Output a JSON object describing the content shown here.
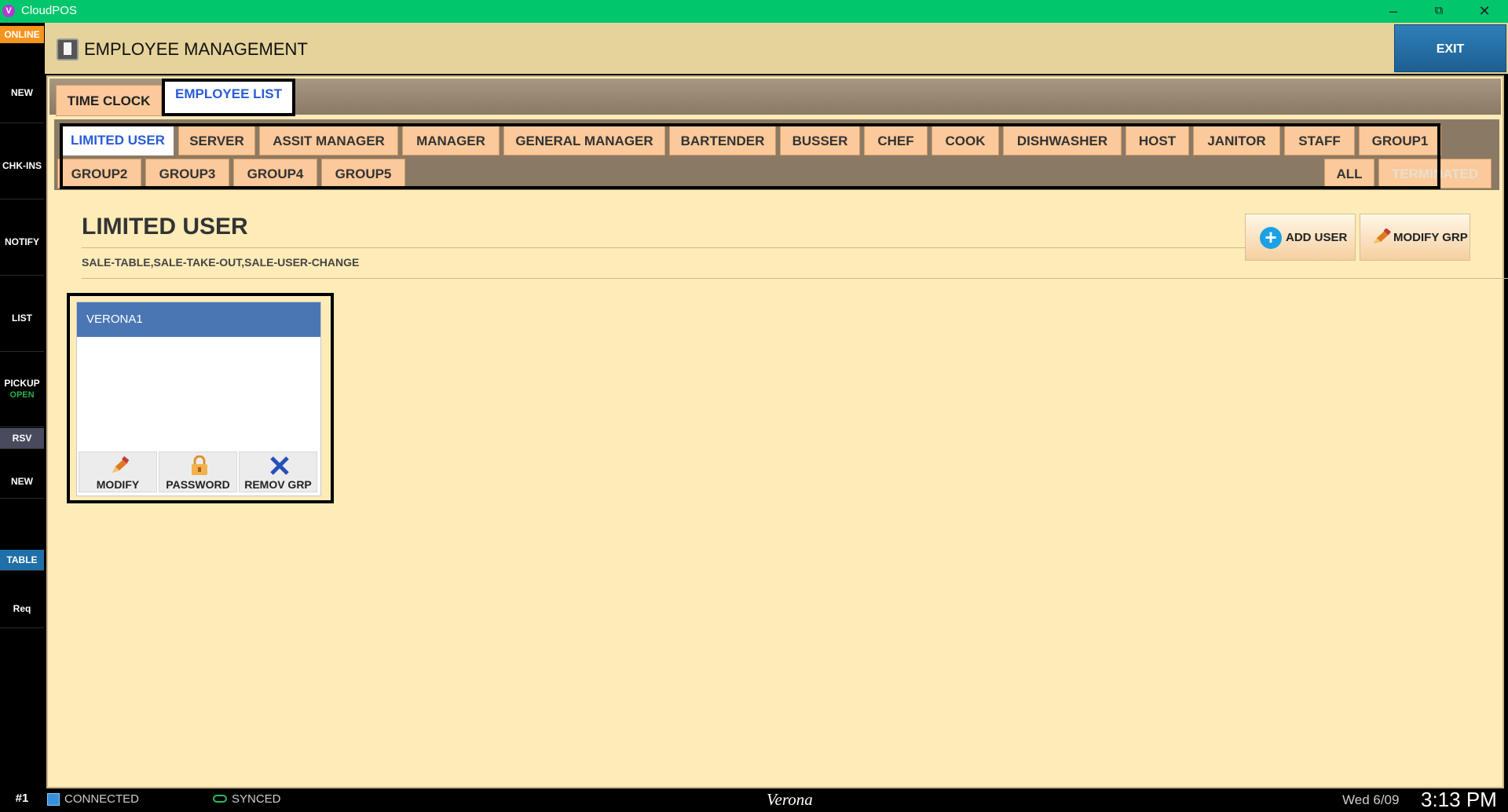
{
  "window": {
    "title": "CloudPOS",
    "app_icon_letter": "V"
  },
  "sidebar": {
    "online_label": "ONLINE",
    "buttons": [
      "NEW",
      "CHK-INS",
      "NOTIFY",
      "LIST",
      "PICKUP"
    ],
    "pickup_status": "OPEN",
    "section_rsv": "RSV",
    "rsv_new": "NEW",
    "section_table": "TABLE",
    "req": "Req"
  },
  "header": {
    "title": "EMPLOYEE MANAGEMENT",
    "exit_label": "EXIT"
  },
  "tabs": {
    "time_clock": "TIME CLOCK",
    "employee_list": "EMPLOYEE LIST"
  },
  "groups": {
    "row1": [
      "LIMITED USER",
      "SERVER",
      "ASSIT MANAGER",
      "MANAGER",
      "GENERAL MANAGER",
      "BARTENDER",
      "BUSSER",
      "CHEF",
      "COOK",
      "DISHWASHER",
      "HOST",
      "JANITOR",
      "STAFF",
      "GROUP1"
    ],
    "row2": [
      "GROUP2",
      "GROUP3",
      "GROUP4",
      "GROUP5"
    ],
    "all": "ALL",
    "terminated": "TERMINATED",
    "selected": "LIMITED USER"
  },
  "group_detail": {
    "title": "LIMITED USER",
    "permissions": "SALE-TABLE,SALE-TAKE-OUT,SALE-USER-CHANGE",
    "add_user_label": "ADD USER",
    "modify_grp_label": "MODIFY GRP"
  },
  "employees": [
    {
      "name": "VERONA1",
      "actions": [
        "MODIFY",
        "PASSWORD",
        "REMOV GRP"
      ]
    }
  ],
  "status": {
    "station": "#1",
    "connection": "CONNECTED",
    "sync": "SYNCED",
    "brand": "Verona",
    "date": "Wed 6/09",
    "time": "3:13 PM"
  },
  "colors": {
    "title_bar": "#02c66c",
    "accent_blue": "#2a5bd7",
    "tab_orange": "#fbc99a",
    "exit_blue": "#1d5f93"
  }
}
